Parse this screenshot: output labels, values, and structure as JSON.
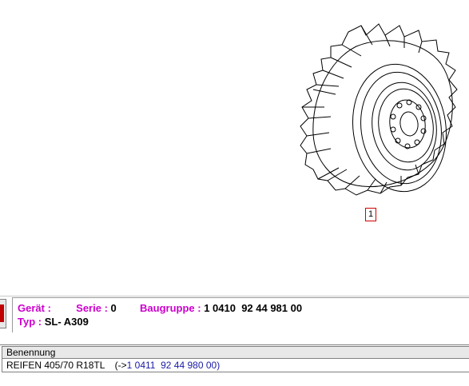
{
  "diagram": {
    "callout_number": "1"
  },
  "info": {
    "geraet_label": "Gerät :",
    "geraet_value": "",
    "serie_label": "Serie :",
    "serie_value": "0",
    "baugruppe_label": "Baugruppe :",
    "baugruppe_value": "1 0410  92 44 981 00",
    "typ_label": "Typ :",
    "typ_value": "SL- A309"
  },
  "table": {
    "header": "Benennung",
    "rows": [
      {
        "name": "REIFEN 405/70 R18TL",
        "ref_prefix": "(->",
        "ref_number": "1 0411  92 44 980 00",
        "ref_suffix": ")"
      }
    ]
  },
  "colors": {
    "label_magenta": "#cc00cc",
    "callout_border": "#cc0000",
    "reference_blue": "#1a1aa6"
  }
}
